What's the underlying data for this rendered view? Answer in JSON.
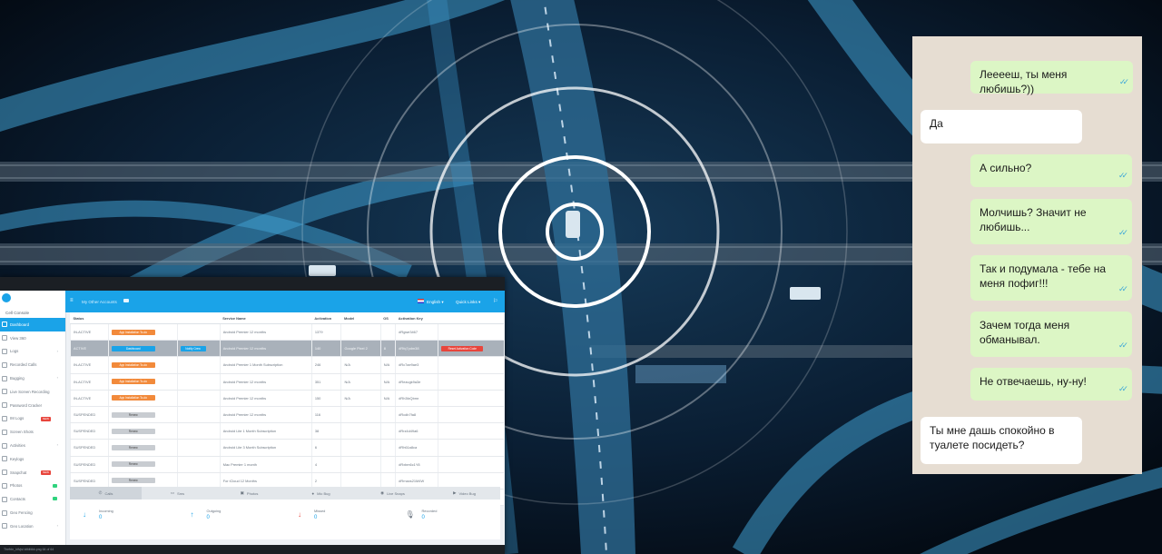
{
  "dashboard": {
    "sidebar": {
      "brand": "Cell Console",
      "items": [
        {
          "label": "Dashboard",
          "active": true
        },
        {
          "label": "View 360"
        },
        {
          "label": "Logs",
          "chevron": true
        },
        {
          "label": "Recorded Calls"
        },
        {
          "label": "Bugging",
          "chevron": true
        },
        {
          "label": "Live Screen Recording"
        },
        {
          "label": "Password Cracker"
        },
        {
          "label": "IM Logs",
          "badge": "NEW"
        },
        {
          "label": "Screen Shots"
        },
        {
          "label": "Activities",
          "chevron": true
        },
        {
          "label": "Keylogs"
        },
        {
          "label": "Snapchat",
          "badge": "NEW"
        },
        {
          "label": "Photos",
          "green": true
        },
        {
          "label": "Contacts",
          "green": true
        },
        {
          "label": "Geo Fencing"
        },
        {
          "label": "Geo Location",
          "chevron": true
        }
      ]
    },
    "topbar": {
      "account": "My Other Accounts",
      "language": "English",
      "user": "Quick Links"
    },
    "table": {
      "headers": [
        "Status",
        "",
        "",
        "Service Name",
        "Activation",
        "Model",
        "OS",
        "Activation Key",
        ""
      ],
      "rows": [
        {
          "status": "IN-ACTIVE",
          "btn1": "App Installation To-do",
          "btn1_kind": "orange",
          "service": "Android Premier 12 months",
          "activation": "1379",
          "model": "",
          "os": "",
          "key": "#Rgwe3467",
          "highlight": false
        },
        {
          "status": "ACTIVE",
          "btn1": "Dashboard",
          "btn1_kind": "blue",
          "btn2": "Notify Crew",
          "service": "Android Premier 12 months",
          "activation": "140",
          "model": "Google Pixel 2",
          "os": "8",
          "key": "#Rfq7pdm38",
          "reset": "Reset Activation Code",
          "highlight": true
        },
        {
          "status": "IN-ACTIVE",
          "btn1": "App Installation To-do",
          "btn1_kind": "orange",
          "service": "Android Premier 1 Month Subscription",
          "activation": "246",
          "model": "N/A",
          "os": "N/A",
          "key": "#Rc7ae9ae3",
          "highlight": false
        },
        {
          "status": "IN-ACTIVE",
          "btn1": "App Installation To-do",
          "btn1_kind": "orange",
          "service": "Android Premier 12 months",
          "activation": "351",
          "model": "N/A",
          "os": "N/A",
          "key": "#Rezugk9a3e",
          "highlight": false
        },
        {
          "status": "IN-ACTIVE",
          "btn1": "App Installation To-do",
          "btn1_kind": "orange",
          "service": "Android Premier 12 months",
          "activation": "150",
          "model": "N/A",
          "os": "N/A",
          "key": "#Rh3fzQbmr",
          "highlight": false
        },
        {
          "status": "SUSPENDED",
          "btn1": "Renew",
          "btn1_kind": "grey",
          "service": "Android Premier 12 months",
          "activation": "116",
          "model": "",
          "os": "",
          "key": "#Rcdb7fa8",
          "highlight": false
        },
        {
          "status": "SUSPENDED",
          "btn1": "Renew",
          "btn1_kind": "grey",
          "service": "Android Lite 1 Month Subscription",
          "activation": "38",
          "model": "",
          "os": "",
          "key": "#Rrz4d49a6",
          "highlight": false
        },
        {
          "status": "SUSPENDED",
          "btn1": "Renew",
          "btn1_kind": "grey",
          "service": "Android Lite 3 Month Subscription",
          "activation": "6",
          "model": "",
          "os": "",
          "key": "#Rh61a8ca",
          "highlight": false
        },
        {
          "status": "SUSPENDED",
          "btn1": "Renew",
          "btn1_kind": "grey",
          "service": "Mac Premier 1 month",
          "activation": "4",
          "model": "",
          "os": "",
          "key": "#Rxbm6c1Y8",
          "highlight": false
        },
        {
          "status": "SUSPENDED",
          "btn1": "Renew",
          "btn1_kind": "grey",
          "service": "For iCloud 12 Months",
          "activation": "2",
          "model": "",
          "os": "",
          "key": "#Rrnaxs21M4W",
          "highlight": false
        },
        {
          "status": "SUSPENDED",
          "btn1": "Renew",
          "btn1_kind": "grey",
          "service": "Mac Premier 12 months",
          "activation": "0",
          "model": "",
          "os": "",
          "key": "#Rab5hYrg",
          "highlight": false
        }
      ]
    },
    "tabs": [
      {
        "label": "Calls",
        "icon": "phone-icon",
        "glyph": "✆",
        "active": true
      },
      {
        "label": "Sms",
        "icon": "sms-icon",
        "glyph": "▭"
      },
      {
        "label": "Photos",
        "icon": "photo-icon",
        "glyph": "▣"
      },
      {
        "label": "Mic Bug",
        "icon": "mic-icon",
        "glyph": "●"
      },
      {
        "label": "Live Snaps",
        "icon": "camera-icon",
        "glyph": "◉"
      },
      {
        "label": "Video Bug",
        "icon": "video-icon",
        "glyph": "▶"
      }
    ],
    "stats": [
      {
        "label": "Incoming",
        "value": "0",
        "arrow": "↓",
        "color": "#1aa3e8"
      },
      {
        "label": "Outgoing",
        "value": "0",
        "arrow": "↑",
        "color": "#1aa3e8"
      },
      {
        "label": "Missed",
        "value": "0",
        "arrow": "↓",
        "color": "#e8453c"
      },
      {
        "label": "Recorded",
        "value": "0",
        "arrow": "🎙",
        "color": "#6b7580"
      }
    ],
    "status_bar": "Thefrtn_ldfvjsl ldfdfdkk.png 64 of 64"
  },
  "chat": {
    "messages": [
      {
        "dir": "out",
        "text": "Лееееш, ты меня любишь?))"
      },
      {
        "dir": "in",
        "text": "Да"
      },
      {
        "dir": "out",
        "text": "А сильно?"
      },
      {
        "dir": "out",
        "text": "Молчишь? Значит не любишь..."
      },
      {
        "dir": "out",
        "text": "Так и подумала - тебе на меня пофиг!!!"
      },
      {
        "dir": "out",
        "text": "Зачем тогда меня обманывал."
      },
      {
        "dir": "out",
        "text": "Не отвечаешь, ну-ну!"
      },
      {
        "dir": "in",
        "text": "Ты мне дашь спокойно в туалете посидеть?"
      }
    ]
  },
  "colors": {
    "accent": "#1aa3e8",
    "orange": "#f28a3b",
    "danger": "#e8453c",
    "outgoing_bubble": "#dcf6c5",
    "chat_bg": "#e6ddd2"
  }
}
